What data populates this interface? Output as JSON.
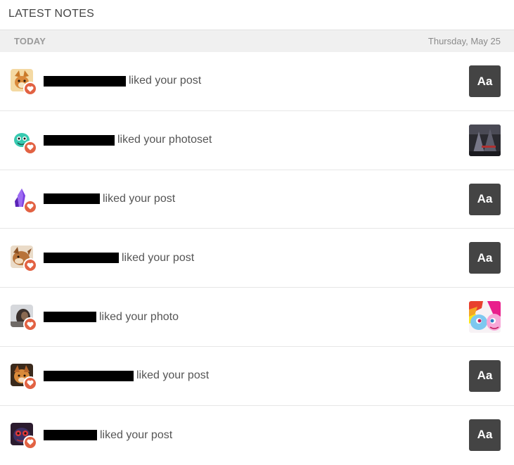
{
  "header": {
    "title": "LATEST NOTES"
  },
  "day": {
    "label": "TODAY",
    "date": "Thursday, May 25"
  },
  "colors": {
    "heart": "#e26243",
    "text_post": "#444444"
  },
  "notes": [
    {
      "action": "liked your post",
      "avatar": "fox-avatar",
      "thumb": "text",
      "thumb_label": "Aa"
    },
    {
      "action": "liked your photoset",
      "avatar": "teal-creature-avatar",
      "thumb": "image",
      "thumb_icon": "dark-photo-thumbnail"
    },
    {
      "action": "liked your post",
      "avatar": "purple-crystal-avatar",
      "thumb": "text",
      "thumb_label": "Aa"
    },
    {
      "action": "liked your post",
      "avatar": "brown-creature-avatar",
      "thumb": "text",
      "thumb_label": "Aa"
    },
    {
      "action": "liked your photo",
      "avatar": "dark-portrait-avatar",
      "thumb": "image",
      "thumb_icon": "pony-photo-thumbnail"
    },
    {
      "action": "liked your post",
      "avatar": "orange-creature-avatar",
      "thumb": "text",
      "thumb_label": "Aa"
    },
    {
      "action": "liked your post",
      "avatar": "red-eyed-avatar",
      "thumb": "text",
      "thumb_label": "Aa"
    }
  ]
}
